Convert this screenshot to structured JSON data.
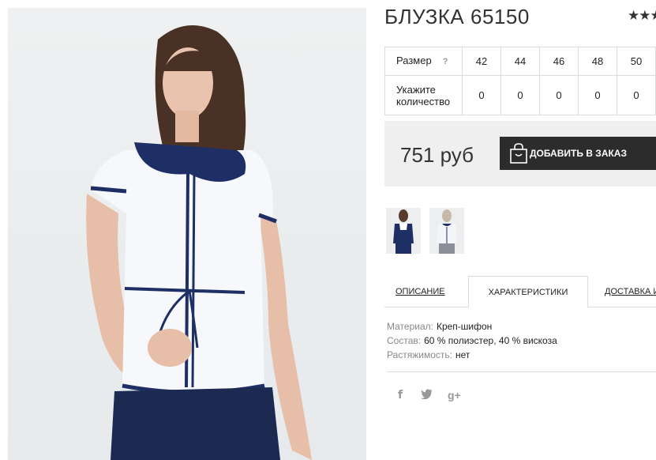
{
  "product": {
    "title": "БЛУЗКА 65150",
    "rating_stars": "★★★"
  },
  "size_table": {
    "size_label": "Размер",
    "size_help": "?",
    "sizes": [
      "42",
      "44",
      "46",
      "48",
      "50"
    ],
    "qty_label": "Укажите количество",
    "quantities": [
      "0",
      "0",
      "0",
      "0",
      "0"
    ]
  },
  "price": {
    "value": "751 руб",
    "button_label": "ДОБАВИТЬ В ЗАКАЗ"
  },
  "tabs": [
    "ОПИСАНИЕ",
    "ХАРАКТЕРИСТИКИ",
    "ДОСТАВКА И"
  ],
  "specs": [
    {
      "key": "Материал:",
      "value": "Креп-шифон"
    },
    {
      "key": "Состав:",
      "value": "60 % полиэстер, 40 % вискоза"
    },
    {
      "key": "Растяжимость:",
      "value": "нет"
    }
  ],
  "social": {
    "facebook": "f",
    "twitter": "🐦",
    "googleplus": "g+"
  },
  "colors": {
    "navy": "#1e2f66",
    "button_bg": "#2c2c2c",
    "price_band_bg": "#efefef"
  }
}
